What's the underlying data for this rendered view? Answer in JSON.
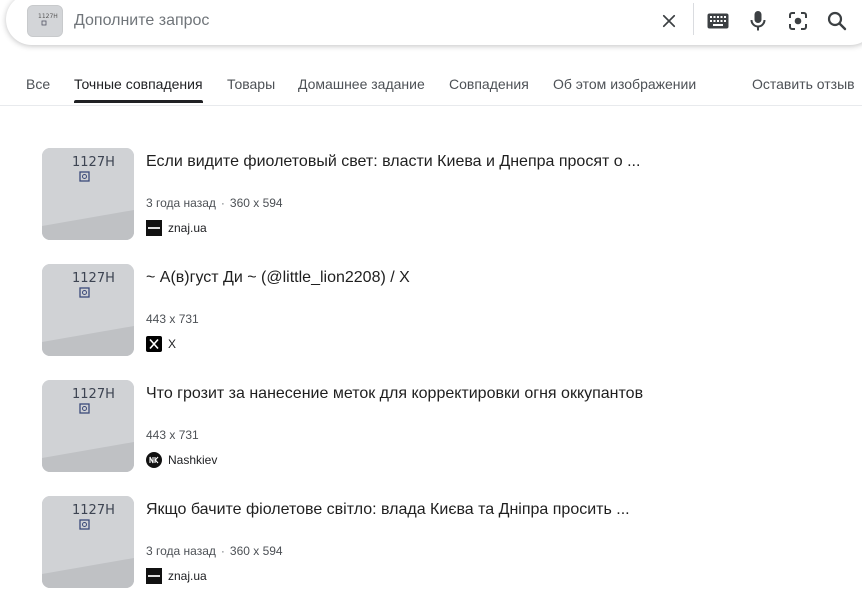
{
  "search": {
    "placeholder": "Дополните запрос",
    "query_thumb_text": "1127Н"
  },
  "icons": {
    "clear": "close-icon",
    "keyboard": "keyboard-icon",
    "voice": "microphone-icon",
    "lens": "camera-lens-icon",
    "search": "search-icon"
  },
  "tabs": [
    {
      "label": "Все",
      "active": false
    },
    {
      "label": "Точные совпадения",
      "active": true
    },
    {
      "label": "Товары",
      "active": false
    },
    {
      "label": "Домашнее задание",
      "active": false
    },
    {
      "label": "Совпадения",
      "active": false
    },
    {
      "label": "Об этом изображении",
      "active": false
    }
  ],
  "feedback_label": "Оставить отзыв",
  "results": [
    {
      "title": "Если видите фиолетовый свет: власти Киева и Днепра просят о ...",
      "age": "3 года назад",
      "size": "360 x 594",
      "source": "znaj.ua",
      "favicon": "znaj-favicon",
      "thumb_text": "1127Н"
    },
    {
      "title": "~ А(в)густ Ди ~ (@little_lion2208) / X",
      "age": "",
      "size": "443 x 731",
      "source": "X",
      "favicon": "x-favicon",
      "thumb_text": "1127Н"
    },
    {
      "title": "Что грозит за нанесение меток для корректировки огня оккупантов",
      "age": "",
      "size": "443 x 731",
      "source": "Nashkiev",
      "favicon": "nashkiev-favicon",
      "thumb_text": "1127Н"
    },
    {
      "title": "Якщо бачите фіолетове світло: влада Києва та Дніпра просить ...",
      "age": "3 года назад",
      "size": "360 x 594",
      "source": "znaj.ua",
      "favicon": "znaj-favicon",
      "thumb_text": "1127Н"
    }
  ],
  "colors": {
    "text_primary": "#202124",
    "text_secondary": "#4d5156",
    "tab_underline": "#202124",
    "divider": "#e8eaed"
  }
}
